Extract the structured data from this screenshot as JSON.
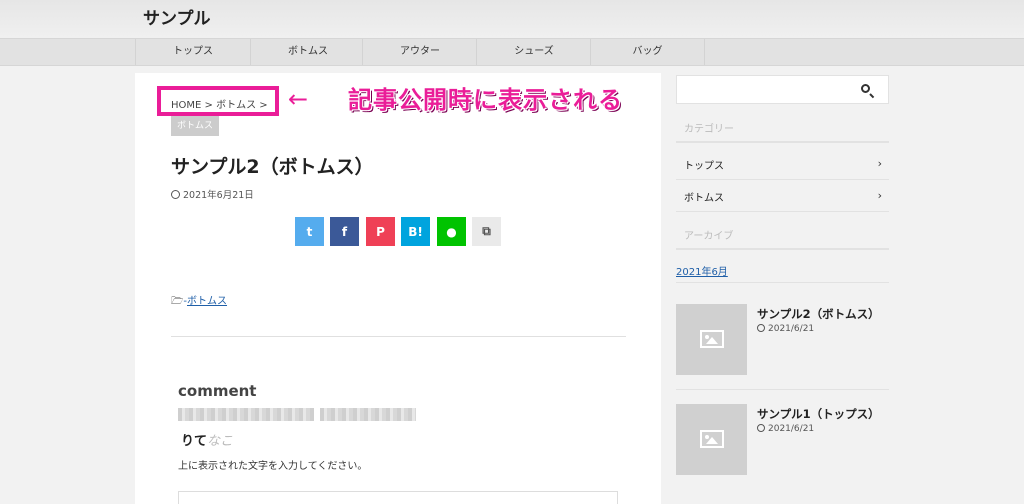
{
  "site": {
    "title": "サンプル"
  },
  "nav": {
    "items": [
      "トップス",
      "ボトムス",
      "アウター",
      "シューズ",
      "バッグ"
    ]
  },
  "breadcrumb": {
    "text": "HOME > ボトムス >"
  },
  "annotation": {
    "arrow": "←",
    "text": "記事公開時に表示される"
  },
  "post": {
    "category_badge": "ボトムス",
    "title": "サンプル2（ボトムス）",
    "date": "2021年6月21日",
    "category_link": "ボトムス",
    "category_prefix": "-"
  },
  "share": {
    "twitter": "t",
    "facebook": "f",
    "pocket": "P",
    "hatena": "B!",
    "line": "●",
    "copy": "⧉"
  },
  "comment": {
    "title": "comment",
    "captcha_text": "りて",
    "captcha_faint": "なこ",
    "instruction": "上に表示された文字を入力してください。"
  },
  "sidebar": {
    "category_heading": "カテゴリー",
    "categories": [
      {
        "label": "トップス",
        "chevron": "›"
      },
      {
        "label": "ボトムス",
        "chevron": "›"
      }
    ],
    "archive_heading": "アーカイブ",
    "archive_link": "2021年6月",
    "recent": [
      {
        "title": "サンプル2（ボトムス）",
        "date": "2021/6/21"
      },
      {
        "title": "サンプル1（トップス）",
        "date": "2021/6/21"
      }
    ]
  },
  "colors": {
    "accent": "#ea1d98",
    "link": "#1f5fa8"
  }
}
